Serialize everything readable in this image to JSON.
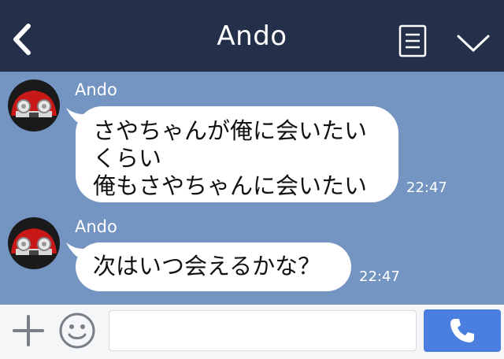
{
  "header": {
    "title": "Ando"
  },
  "messages": [
    {
      "sender": "Ando",
      "lines": [
        "さやちゃんが俺に会いたい",
        "くらい",
        "俺もさやちゃんに会いたい"
      ],
      "time": "22:47"
    },
    {
      "sender": "Ando",
      "lines": [
        "次はいつ会えるかな？"
      ],
      "time": "22:47"
    }
  ],
  "icons": {
    "back": "chevron-left-icon",
    "menu": "document-icon",
    "dropdown": "chevron-down-icon",
    "add": "plus-icon",
    "emoji": "smiley-icon",
    "call": "phone-icon"
  },
  "colors": {
    "header_bg": "#24304a",
    "chat_bg": "#7494c2",
    "bubble_bg": "#ffffff",
    "send_button": "#4a7fe0"
  }
}
